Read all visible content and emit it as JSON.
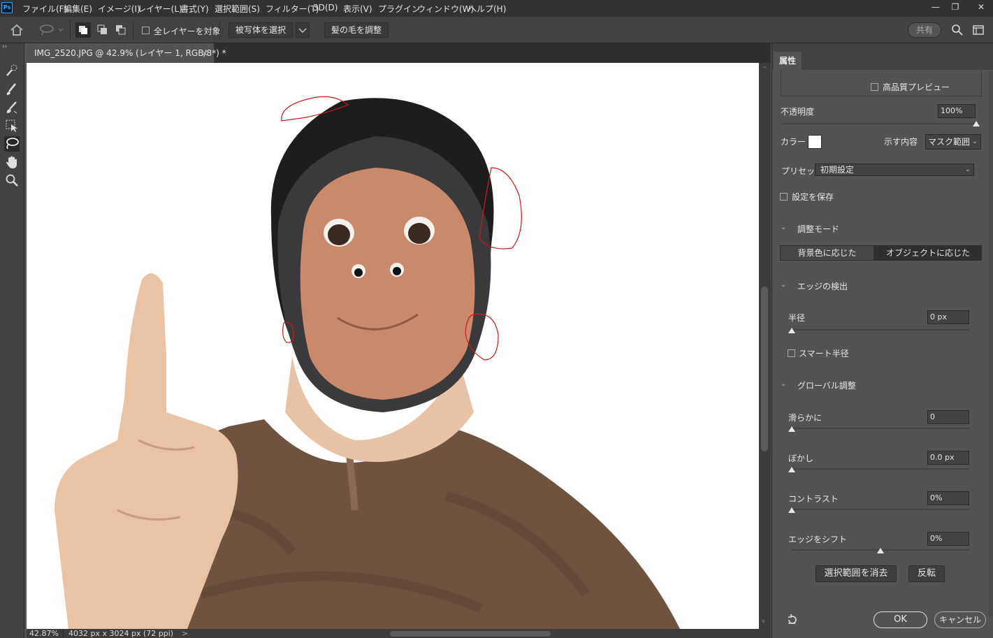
{
  "app": {
    "logo": "Ps",
    "brand_color": "#31a8ff"
  },
  "menu": {
    "items": [
      "ファイル(F)",
      "編集(E)",
      "イメージ(I)",
      "レイヤー(L)",
      "書式(Y)",
      "選択範囲(S)",
      "フィルター(T)",
      "3D(D)",
      "表示(V)",
      "プラグイン",
      "ウィンドウ(W)",
      "ヘルプ(H)"
    ],
    "window_controls": [
      "—",
      "❐",
      "✕"
    ]
  },
  "options": {
    "all_layers_label": "全レイヤーを対象",
    "select_subject_label": "被写体を選択",
    "refine_hair_label": "髪の毛を調整",
    "share_label": "共有"
  },
  "document": {
    "tab_title": "IMG_2520.JPG @ 42.9% (レイヤー 1, RGB/8*) *",
    "tab_close": "×"
  },
  "status": {
    "zoom": "42.87%",
    "dimensions": "4032 px x 3024 px (72 ppi)",
    "arrow": ">"
  },
  "panel": {
    "tab_label": "属性",
    "hq_preview_label": "高品質プレビュー",
    "opacity_label": "不透明度",
    "opacity_value": "100%",
    "opacity_level": 1.0,
    "color_label": "カラー",
    "show_label": "示す内容",
    "show_value": "マスク範囲",
    "preset_label": "プリセット",
    "preset_value": "初期設定",
    "save_settings_label": "設定を保存",
    "adjust_mode_label": "調整モード",
    "mode_bg": "背景色に応じた",
    "mode_obj": "オブジェクトに応じた",
    "edge_detect_label": "エッジの検出",
    "radius_label": "半径",
    "radius_value": "0 px",
    "smart_radius_label": "スマート半径",
    "global_label": "グローバル調整",
    "smooth_label": "滑らかに",
    "smooth_value": "0",
    "feather_label": "ぼかし",
    "feather_value": "0.0 px",
    "contrast_label": "コントラスト",
    "contrast_value": "0%",
    "shift_label": "エッジをシフト",
    "shift_value": "0%",
    "clear_selection_label": "選択範囲を消去",
    "invert_label": "反転",
    "ok_label": "OK",
    "cancel_label": "キャンセル"
  }
}
